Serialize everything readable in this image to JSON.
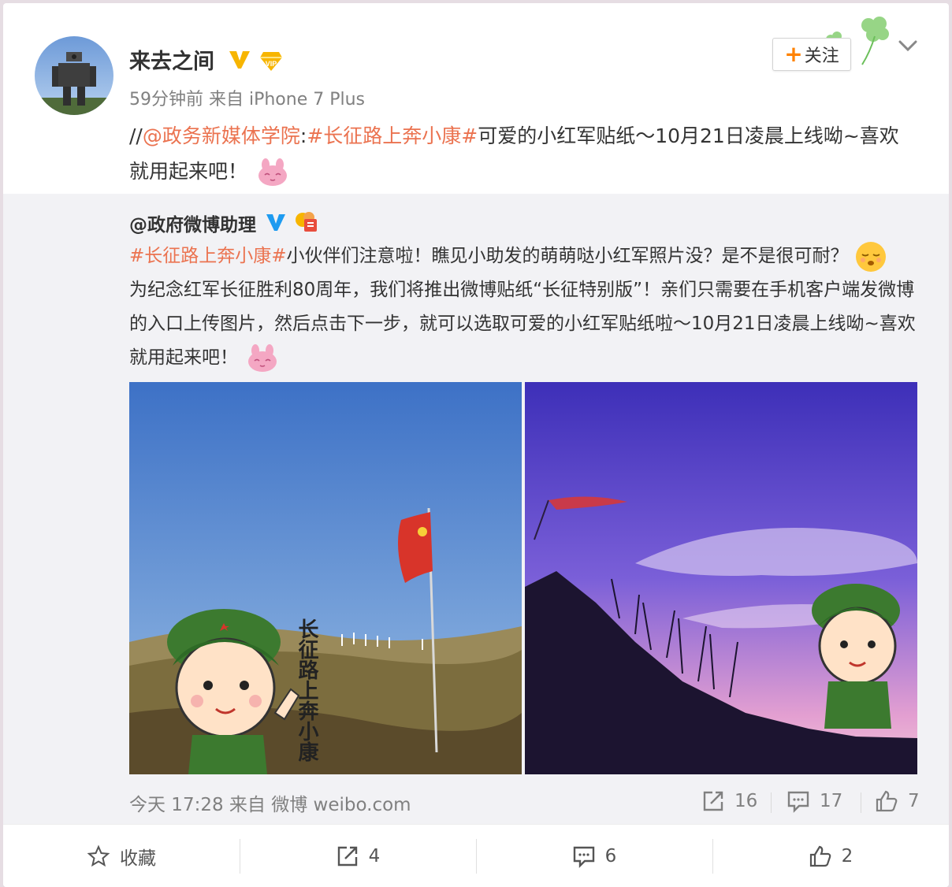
{
  "post": {
    "username": "来去之间",
    "meta": "59分钟前 来自 iPhone 7 Plus",
    "follow_label": "关注",
    "text": {
      "prefix": "//",
      "mention": "@政务新媒体学院",
      "colon": ":",
      "hashtag": "#长征路上奔小康#",
      "body": "可爱的小红军贴纸～10月21日凌晨上线呦~喜欢就用起来吧！"
    }
  },
  "repost": {
    "username": "@政府微博助理",
    "hashtag": "#长征路上奔小康#",
    "line1": "小伙伴们注意啦！瞧见小助发的萌萌哒小红军照片没？是不是很可耐？",
    "line2": "为纪念红军长征胜利80周年，我们将推出微博贴纸“长征特别版”！亲们只需要在手机客户端发微博的入口上传图片，然后点击下一步，就可以选取可爱的小红军贴纸啦～10月21日凌晨上线呦~喜欢就用起来吧！",
    "photo1_caption": "长征路上奔小康",
    "time": "今天 17:28 来自 微博 weibo.com",
    "shares": "16",
    "comments": "17",
    "likes": "7"
  },
  "actions": {
    "favorite": "收藏",
    "forward": "4",
    "comment": "6",
    "like": "2"
  },
  "icons": {
    "verified": "verified-v-icon",
    "vip": "vip-diamond-icon",
    "chevron": "chevron-down-icon",
    "share": "share-icon",
    "comment": "comment-icon",
    "like": "thumbs-up-icon",
    "favorite": "star-icon"
  },
  "colors": {
    "link": "#eb7350",
    "accent": "#ff8200",
    "verified": "#f7b500",
    "gov_verified": "#1e9bf0"
  }
}
